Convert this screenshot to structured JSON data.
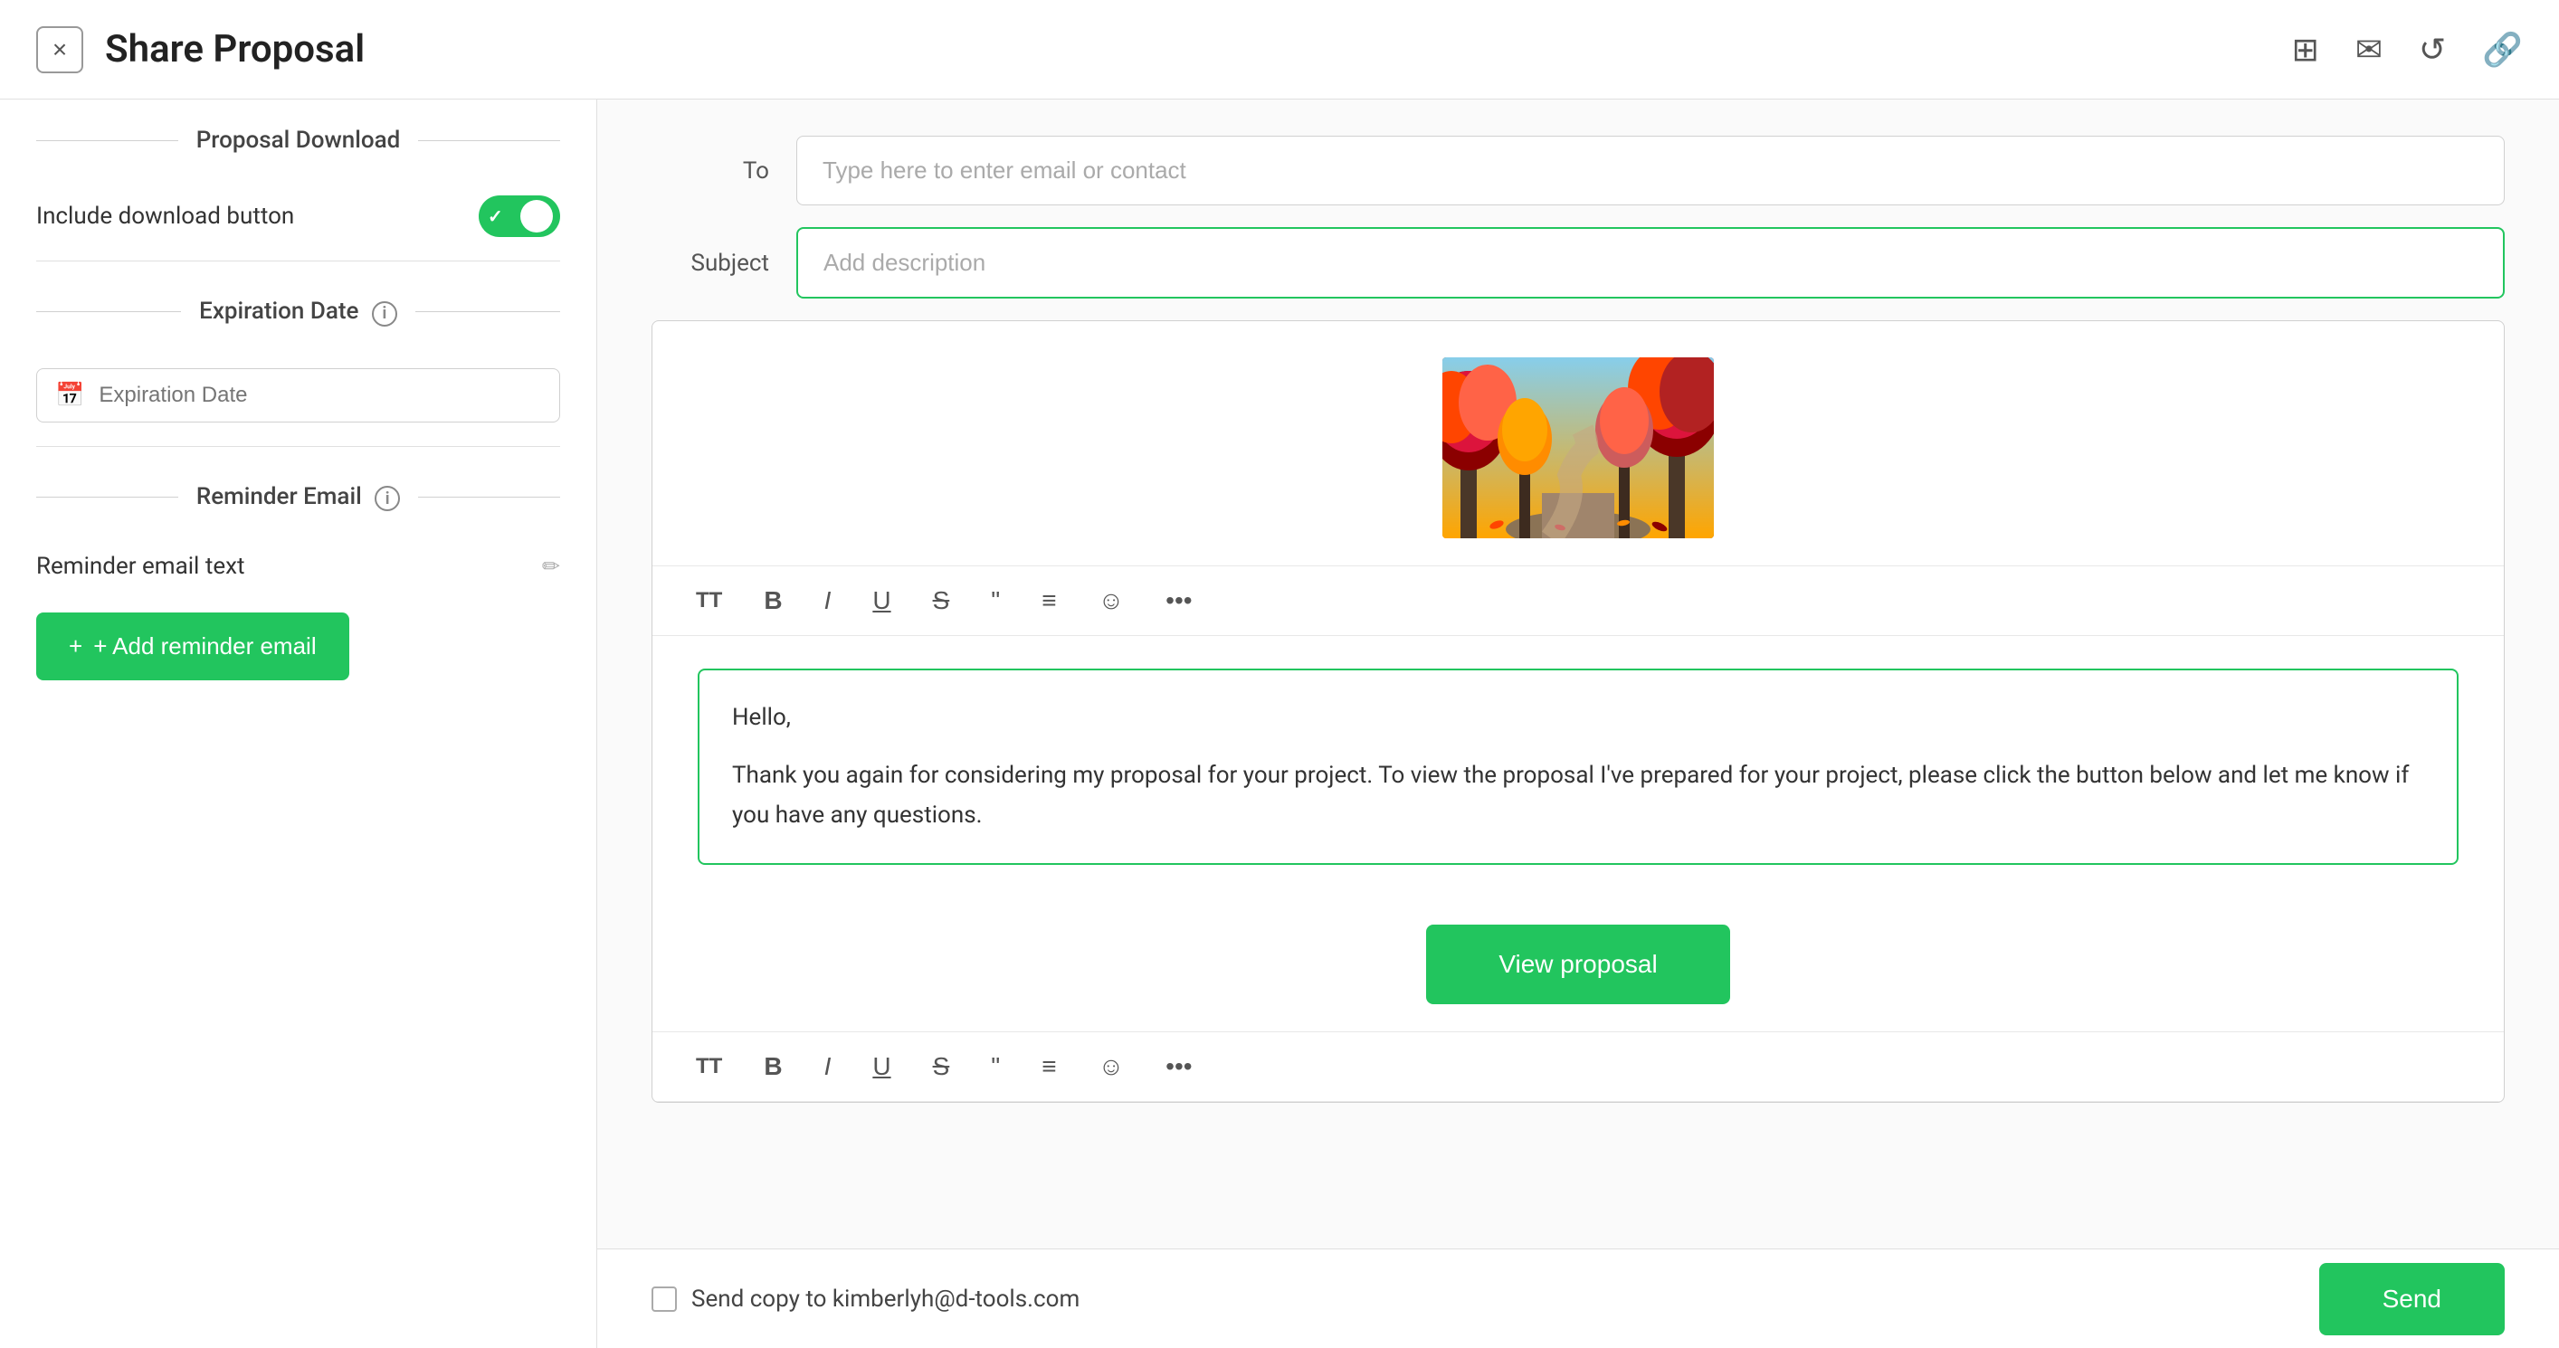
{
  "header": {
    "title": "Share Proposal",
    "close_label": "×"
  },
  "sidebar": {
    "proposal_download_label": "Proposal Download",
    "include_download_label": "Include download button",
    "toggle_checked": true,
    "expiration_date_section": "Expiration Date",
    "expiration_date_placeholder": "Expiration Date",
    "reminder_email_section": "Reminder Email",
    "reminder_email_text_label": "Reminder email text",
    "add_reminder_label": "+ Add reminder email"
  },
  "email_form": {
    "to_label": "To",
    "to_placeholder": "Type here to enter email or contact",
    "subject_label": "Subject",
    "subject_placeholder": "Add description",
    "toolbar_buttons": [
      "TT",
      "B",
      "I",
      "U",
      "S",
      "❝",
      "≡",
      "☺",
      "..."
    ],
    "email_greeting": "Hello,",
    "email_body": "Thank you again for considering my proposal for your project. To view the proposal I've prepared for your project, please click the button below and let me know if you have any questions.",
    "view_proposal_label": "View proposal"
  },
  "footer": {
    "send_copy_text": "Send copy to kimberlyh@d-tools.com",
    "send_label": "Send"
  },
  "icons": {
    "close": "×",
    "layout": "⊞",
    "email": "✉",
    "undo": "↺",
    "link": "🔗",
    "calendar": "📅",
    "edit": "✏",
    "plus": "+"
  }
}
